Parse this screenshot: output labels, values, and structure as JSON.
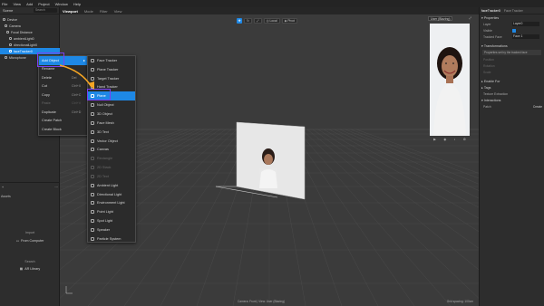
{
  "menubar": {
    "items": [
      "File",
      "View",
      "Add",
      "Project",
      "Window",
      "Help"
    ]
  },
  "left_panel": {
    "title": "Scene",
    "search_placeholder": "Search",
    "tree": [
      {
        "label": "Device",
        "indent": 0
      },
      {
        "label": "Camera",
        "indent": 1
      },
      {
        "label": "Focal Distance",
        "indent": 2
      },
      {
        "label": "ambientLight0",
        "indent": 3
      },
      {
        "label": "directionalLight0",
        "indent": 3
      },
      {
        "label": "faceTracker0",
        "indent": 3,
        "selected": true
      },
      {
        "label": "Microphone",
        "indent": 1
      }
    ],
    "assets_label": "Assets",
    "import_label": "Import",
    "from_computer": "From Computer",
    "search_label": "Search",
    "ar_library": "AR Library"
  },
  "viewport": {
    "tabs": [
      "Viewport",
      "Mode",
      "Filter",
      "View"
    ],
    "toolbar_local": "Local",
    "toolbar_pivot": "Pivot",
    "device": "User (Blazing)",
    "footer_center": "Camera: Front | View: User (Blazing)",
    "footer_right": "Grid spacing: 100cm"
  },
  "context_menu": {
    "items": [
      {
        "label": "Add Object",
        "has_submenu": true,
        "highlighted": true
      },
      {
        "label": "Rename",
        "shortcut": ""
      },
      {
        "label": "Delete",
        "shortcut": "Del"
      },
      {
        "label": "Cut",
        "shortcut": "Ctrl+X"
      },
      {
        "label": "Copy",
        "shortcut": "Ctrl+C"
      },
      {
        "label": "Paste",
        "shortcut": "Ctrl+V",
        "disabled": true
      },
      {
        "label": "Duplicate",
        "shortcut": "Ctrl+D"
      },
      {
        "label": "Create Patch",
        "shortcut": ""
      },
      {
        "label": "Create Block",
        "shortcut": ""
      }
    ]
  },
  "submenu": {
    "items": [
      {
        "label": "Face Tracker"
      },
      {
        "label": "Plane Tracker"
      },
      {
        "label": "Target Tracker"
      },
      {
        "label": "Hand Tracker"
      },
      {
        "label": "Plane",
        "highlighted": true
      },
      {
        "label": "Null Object"
      },
      {
        "label": "3D Object"
      },
      {
        "label": "Face Mesh"
      },
      {
        "label": "3D Text"
      },
      {
        "label": "Vector Object"
      },
      {
        "label": "Canvas"
      },
      {
        "label": "Rectangle",
        "disabled": true
      },
      {
        "label": "2D Stack",
        "disabled": true
      },
      {
        "label": "2D Text",
        "disabled": true
      },
      {
        "label": "Ambient Light"
      },
      {
        "label": "Directional Light"
      },
      {
        "label": "Environment Light"
      },
      {
        "label": "Point Light"
      },
      {
        "label": "Spot Light"
      },
      {
        "label": "Speaker"
      },
      {
        "label": "Particle System"
      }
    ]
  },
  "right_panel": {
    "title": "faceTracker0",
    "subtitle": "Face Tracker",
    "properties": "Properties",
    "layer_label": "Layer",
    "layer_value": "Layer0",
    "visible_label": "Visible",
    "tracked_face_label": "Tracked Face",
    "tracked_face_value": "Face 1",
    "transformations": "Transformations",
    "info": "Properties set by the tracked face",
    "position": "Position",
    "rotation": "Rotation",
    "scale": "Scale",
    "enable_for": "Enable For",
    "tags": "Tags",
    "texture_extraction": "Texture Extraction",
    "interactions": "Interactions",
    "patch": "Patch",
    "create": "Create"
  },
  "colors": {
    "accent": "#1e88e5",
    "highlight": "#7b3ff2",
    "arrow": "#f6a623"
  }
}
